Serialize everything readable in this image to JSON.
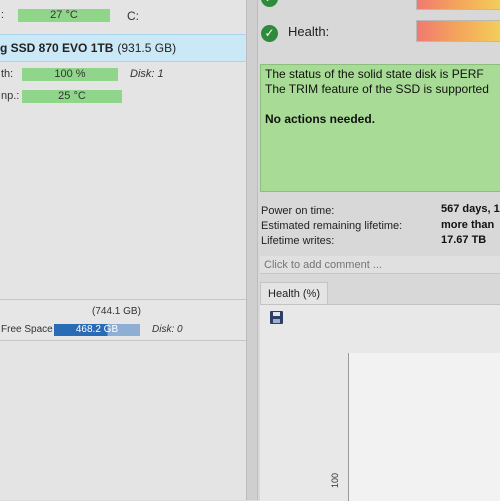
{
  "left": {
    "top_row": {
      "temp_value": "27 °C",
      "drive_letter": "C:",
      "label_prefix": ":"
    },
    "selected_disk": {
      "name_bold": "g SSD 870 EVO 1TB",
      "capacity": "(931.5 GB)"
    },
    "health_row": {
      "label": "th:",
      "value": "100 %",
      "disk": "Disk: 1"
    },
    "temp_row": {
      "label": "np.:",
      "value": "25 °C"
    },
    "volume": {
      "capacity": "(744.1 GB)",
      "free_label": "Free Space",
      "free_value": "468.2 GB",
      "disk": "Disk: 0"
    }
  },
  "right": {
    "health_label": "Health:",
    "status": {
      "line1": "The status of the solid state disk is PERF",
      "line2": "The TRIM feature of the SSD is supported",
      "line3": "No actions needed."
    },
    "info": [
      {
        "label": "Power on time:",
        "value": "567 days, 1"
      },
      {
        "label": "Estimated remaining lifetime:",
        "value": "more than"
      },
      {
        "label": "Lifetime writes:",
        "value": "17.67 TB"
      }
    ],
    "comment_placeholder": "Click to add comment ...",
    "tab_label": "Health (%)",
    "chart_axis_label": "100"
  },
  "colors": {
    "status_green": "#a8dc96",
    "bar_green": "#8fd68a",
    "selected_blue": "#cbe8f6",
    "check_green": "#2f8b3c",
    "free_space_blue": "#2a6bb6"
  },
  "icons": [
    "check-circle-icon",
    "save-icon"
  ]
}
